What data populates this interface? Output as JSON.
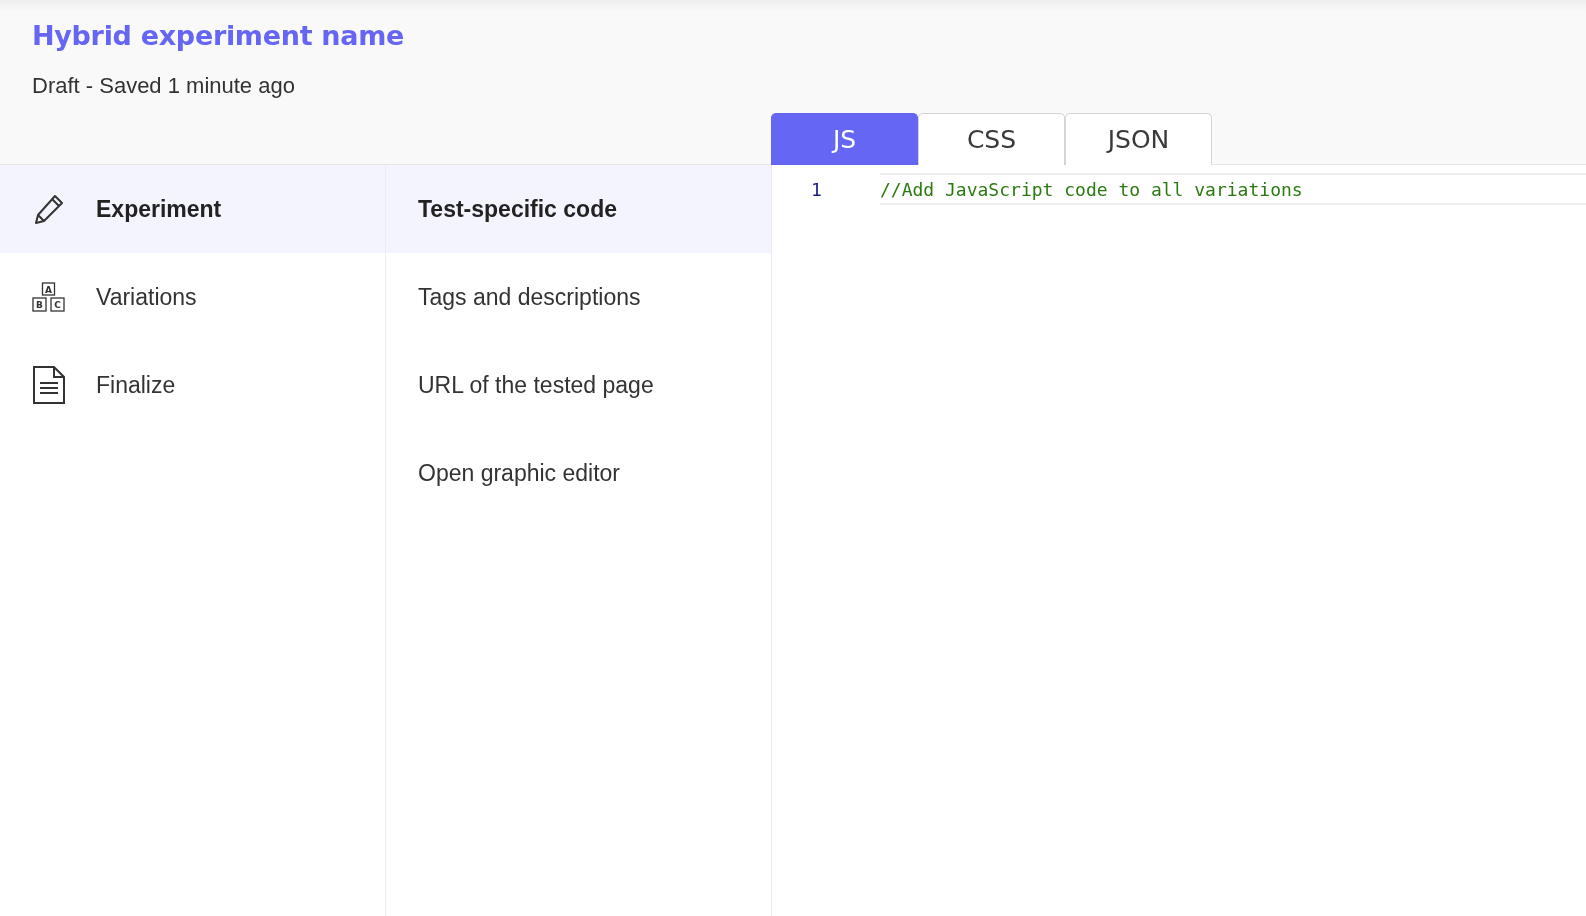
{
  "header": {
    "title": "Hybrid experiment name",
    "status": "Draft - Saved 1 minute ago"
  },
  "tabs": [
    {
      "label": "JS",
      "selected": true
    },
    {
      "label": "CSS",
      "selected": false
    },
    {
      "label": "JSON",
      "selected": false
    }
  ],
  "steps": [
    {
      "label": "Experiment",
      "kind": "pencil",
      "selected": true
    },
    {
      "label": "Variations",
      "kind": "blocks",
      "icon_letters": [
        "A",
        "B",
        "C"
      ],
      "selected": false
    },
    {
      "label": "Finalize",
      "kind": "document",
      "selected": false
    }
  ],
  "sections": [
    {
      "label": "Test-specific code",
      "selected": true
    },
    {
      "label": "Tags and descriptions",
      "selected": false
    },
    {
      "label": "URL of the tested page",
      "selected": false
    },
    {
      "label": "Open graphic editor",
      "selected": false
    }
  ],
  "editor": {
    "lines": [
      {
        "number": "1",
        "code": "//Add JavaScript code to all variations"
      }
    ]
  }
}
